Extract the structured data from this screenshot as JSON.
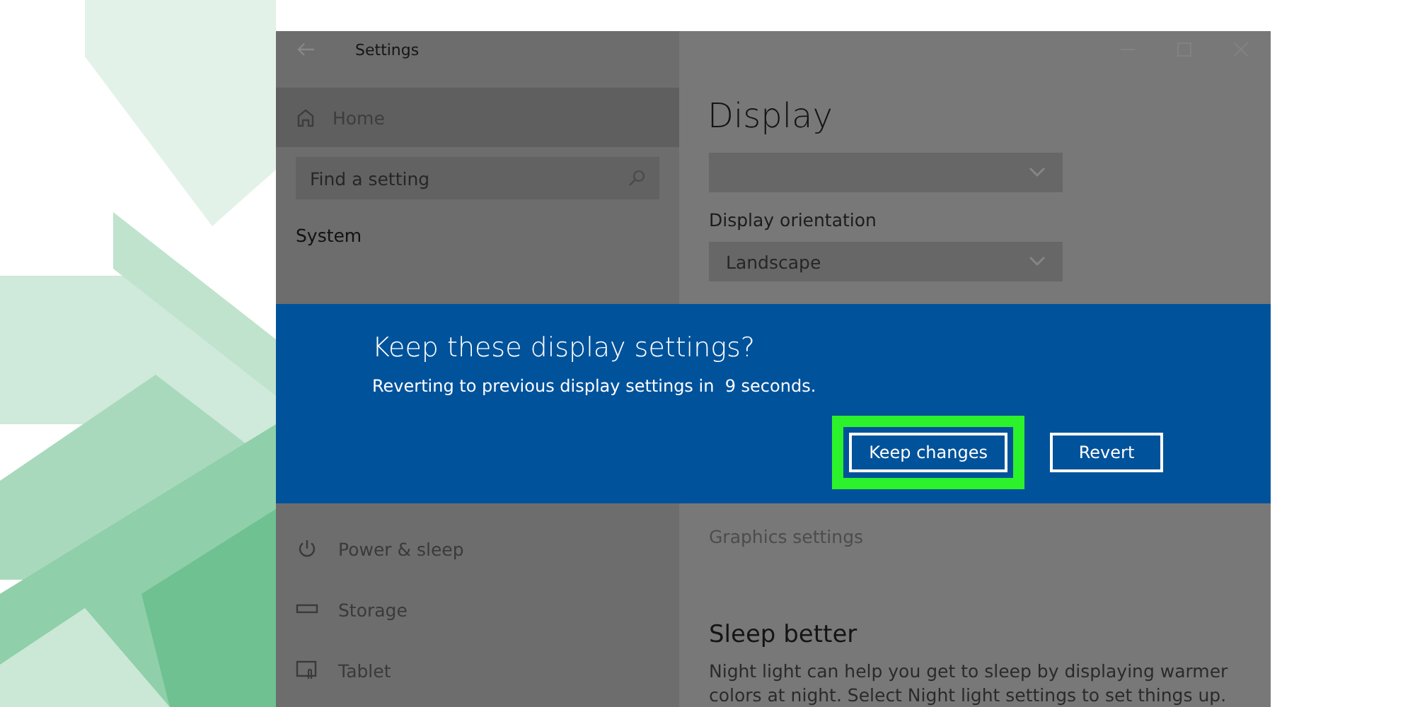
{
  "window": {
    "title": "Settings"
  },
  "sidebar": {
    "home": "Home",
    "search": {
      "placeholder": "Find a setting"
    },
    "section": "System",
    "items": [
      {
        "label": "Power & sleep"
      },
      {
        "label": "Storage"
      },
      {
        "label": "Tablet"
      }
    ]
  },
  "content": {
    "heading": "Display",
    "controls": [
      {
        "kind": "dropdown"
      },
      {
        "kind": "label",
        "text": "Display orientation"
      },
      {
        "kind": "dropdown",
        "value": "Landscape"
      }
    ],
    "link": "Graphics settings",
    "section": {
      "title": "Sleep better",
      "text": "Night light can help you get to sleep by displaying warmer colors at night. Select Night light settings to set things up."
    }
  },
  "dialog": {
    "title": "Keep these display settings?",
    "message": "Reverting to previous display settings in  9 seconds.",
    "buttons": [
      {
        "label": "Keep changes",
        "highlighted": true
      },
      {
        "label": "Revert",
        "highlighted": false
      }
    ]
  }
}
